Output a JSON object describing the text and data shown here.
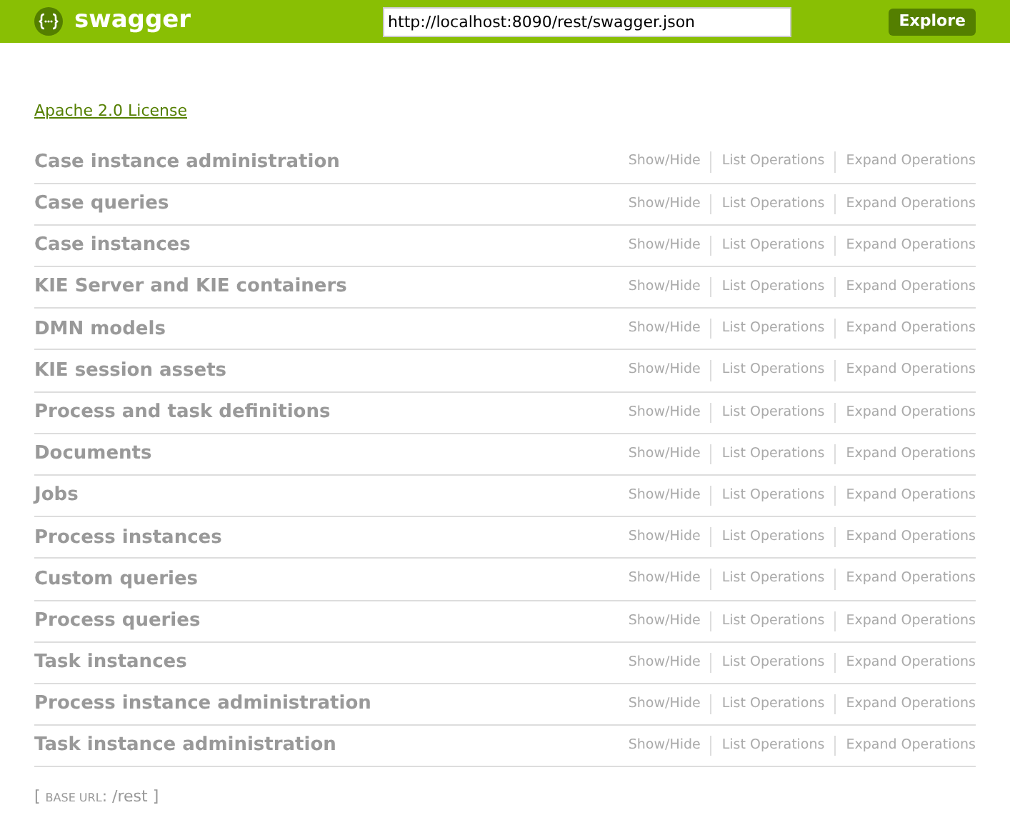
{
  "header": {
    "logo": "swagger",
    "url": "http://localhost:8090/rest/swagger.json",
    "button": "Explore"
  },
  "license": "Apache 2.0 License",
  "resources": [
    {
      "name": "Case instance administration",
      "actions": [
        "Show/Hide",
        "List Operations",
        "Expand Operations"
      ]
    },
    {
      "name": "Case queries",
      "actions": [
        "Show/Hide",
        "List Operations",
        "Expand Operations"
      ]
    },
    {
      "name": "Case instances",
      "actions": [
        "Show/Hide",
        "List Operations",
        "Expand Operations"
      ]
    },
    {
      "name": "KIE Server and KIE containers",
      "actions": [
        "Show/Hide",
        "List Operations",
        "Expand Operations"
      ]
    },
    {
      "name": "DMN models",
      "actions": [
        "Show/Hide",
        "List Operations",
        "Expand Operations"
      ]
    },
    {
      "name": "KIE session assets",
      "actions": [
        "Show/Hide",
        "List Operations",
        "Expand Operations"
      ]
    },
    {
      "name": "Process and task definitions",
      "actions": [
        "Show/Hide",
        "List Operations",
        "Expand Operations"
      ]
    },
    {
      "name": "Documents",
      "actions": [
        "Show/Hide",
        "List Operations",
        "Expand Operations"
      ]
    },
    {
      "name": "Jobs",
      "actions": [
        "Show/Hide",
        "List Operations",
        "Expand Operations"
      ]
    },
    {
      "name": "Process instances",
      "actions": [
        "Show/Hide",
        "List Operations",
        "Expand Operations"
      ]
    },
    {
      "name": "Custom queries",
      "actions": [
        "Show/Hide",
        "List Operations",
        "Expand Operations"
      ]
    },
    {
      "name": "Process queries",
      "actions": [
        "Show/Hide",
        "List Operations",
        "Expand Operations"
      ]
    },
    {
      "name": "Task instances",
      "actions": [
        "Show/Hide",
        "List Operations",
        "Expand Operations"
      ]
    },
    {
      "name": "Process instance administration",
      "actions": [
        "Show/Hide",
        "List Operations",
        "Expand Operations"
      ]
    },
    {
      "name": "Task instance administration",
      "actions": [
        "Show/Hide",
        "List Operations",
        "Expand Operations"
      ]
    }
  ],
  "footer": {
    "open": "[",
    "label": "BASE URL",
    "value": ": /rest",
    "close": "]"
  }
}
